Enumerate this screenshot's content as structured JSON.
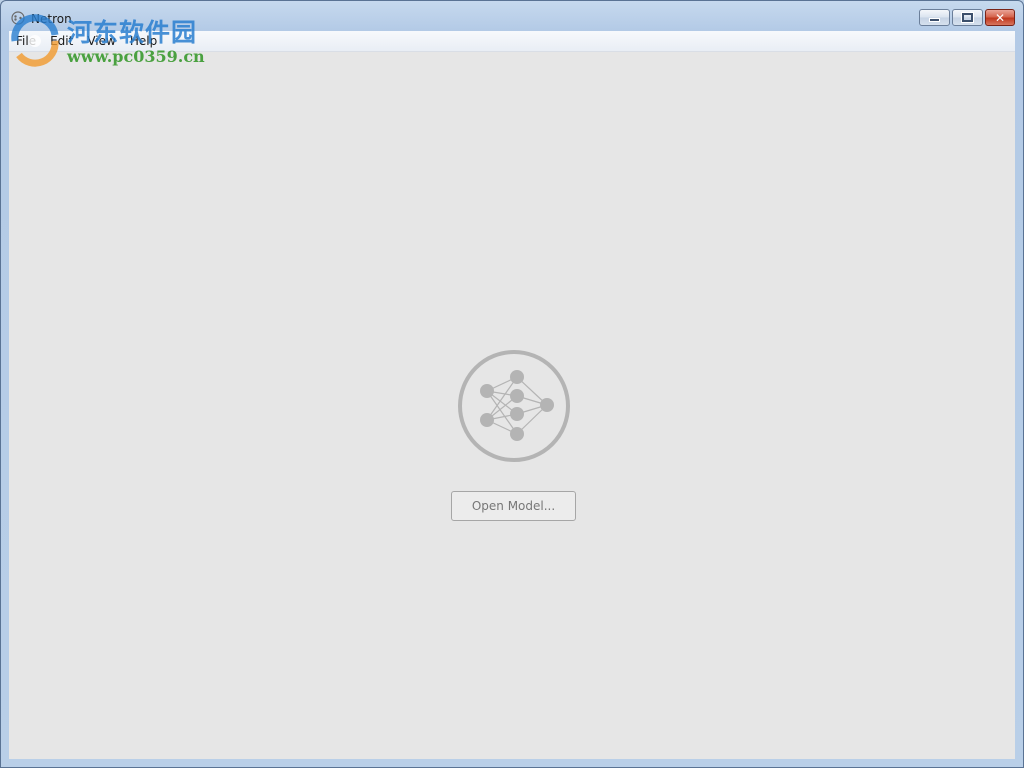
{
  "window": {
    "title": "Netron",
    "buttons": {
      "minimize_icon": "minimize-icon",
      "maximize_icon": "maximize-icon",
      "close_icon": "close-icon",
      "close_glyph": "✕"
    }
  },
  "menu": {
    "items": [
      {
        "label": "File"
      },
      {
        "label": "Edit"
      },
      {
        "label": "View"
      },
      {
        "label": "Help"
      }
    ]
  },
  "main": {
    "logo_icon": "neural-network-logo-icon",
    "open_button_label": "Open Model..."
  },
  "watermark": {
    "chinese_text": "河东软件园",
    "url": "www.pc0359.cn"
  },
  "colors": {
    "content_bg": "#e6e6e6",
    "logo_gray": "#b4b4b4",
    "watermark_blue": "#2a7fd0",
    "watermark_green": "#3a9a2f",
    "close_red": "#c0391f"
  }
}
